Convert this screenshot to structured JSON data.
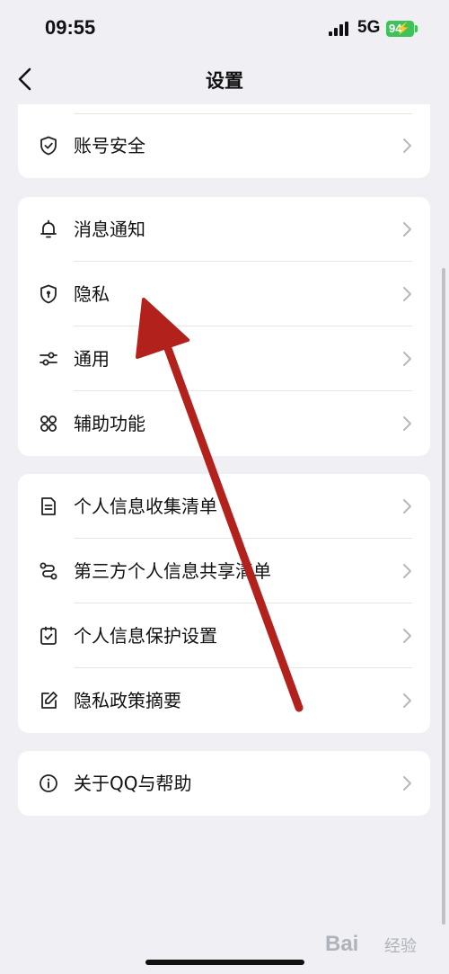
{
  "status_bar": {
    "time": "09:55",
    "network": "5G",
    "battery": "94"
  },
  "nav": {
    "title": "设置"
  },
  "groups": [
    {
      "items": [
        {
          "label": "账号安全",
          "icon": "shield-check-icon"
        }
      ]
    },
    {
      "items": [
        {
          "label": "消息通知",
          "icon": "bell-icon"
        },
        {
          "label": "隐私",
          "icon": "shield-lock-icon"
        },
        {
          "label": "通用",
          "icon": "sliders-icon"
        },
        {
          "label": "辅助功能",
          "icon": "grid-circles-icon"
        }
      ]
    },
    {
      "items": [
        {
          "label": "个人信息收集清单",
          "icon": "document-list-icon"
        },
        {
          "label": "第三方个人信息共享清单",
          "icon": "share-route-icon"
        },
        {
          "label": "个人信息保护设置",
          "icon": "checkbox-icon"
        },
        {
          "label": "隐私政策摘要",
          "icon": "edit-icon"
        }
      ]
    },
    {
      "items": [
        {
          "label": "关于QQ与帮助",
          "icon": "info-icon"
        }
      ]
    }
  ],
  "watermark": {
    "brand": "Bai",
    "sub": "经验"
  },
  "colors": {
    "background": "#efeff4",
    "card": "#ffffff",
    "annotation_arrow": "#b3211c",
    "battery": "#3fc25a"
  }
}
